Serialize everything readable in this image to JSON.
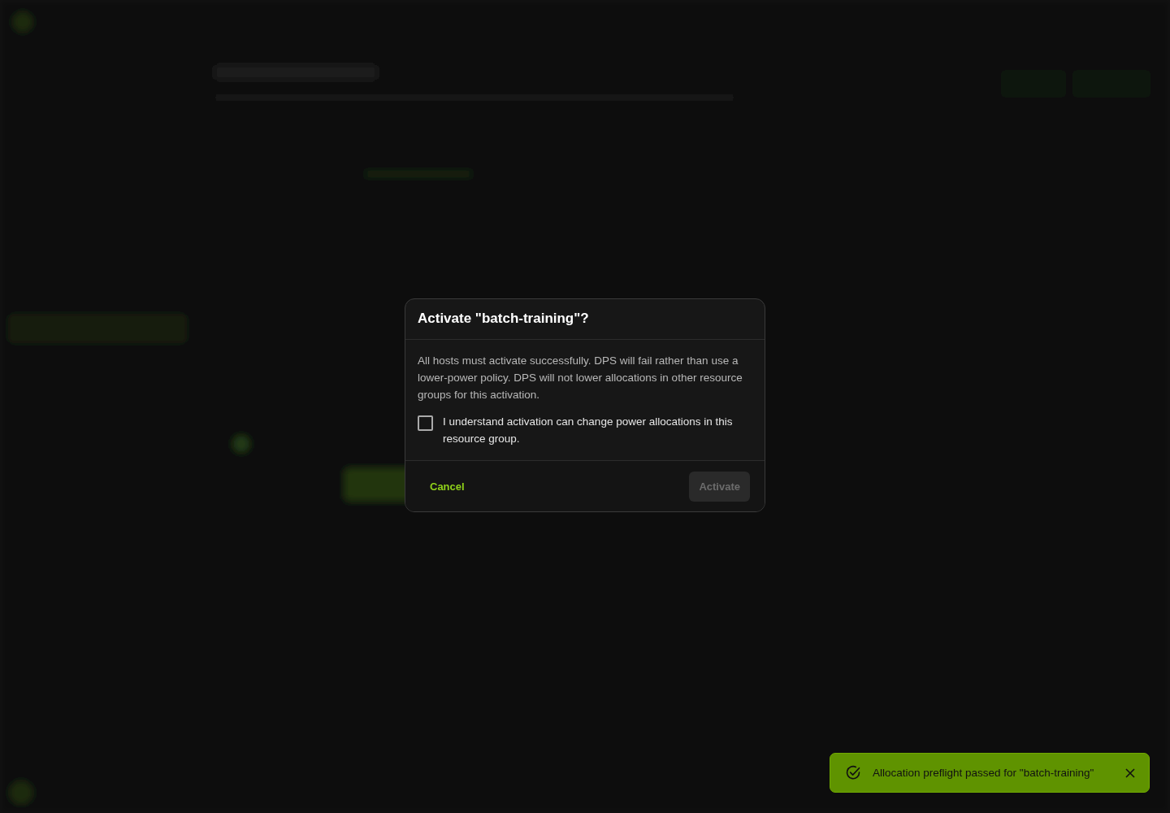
{
  "dialog": {
    "title": "Activate \"batch-training\"?",
    "message": "All hosts must activate successfully. DPS will fail rather than use a lower-power policy. DPS will not lower allocations in other resource groups for this activation.",
    "confirmation": {
      "label": "I understand activation can change power allocations in this resource group.",
      "checked": false
    },
    "buttons": [
      {
        "label": "Cancel",
        "kind": "text",
        "disabled": false
      },
      {
        "label": "Activate",
        "kind": "filled",
        "disabled": true
      }
    ]
  },
  "toast": {
    "message": "Allocation preflight passed for \"batch-training\"",
    "kind": "success"
  }
}
